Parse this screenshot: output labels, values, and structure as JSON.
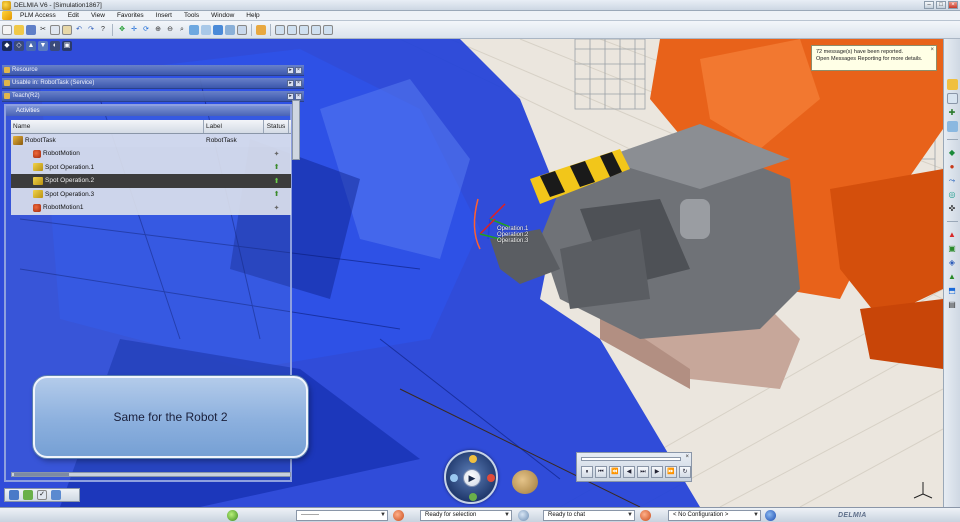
{
  "window": {
    "title": "DELMIA V6 - [Simulation1867]",
    "controls": [
      "–",
      "□",
      "×"
    ]
  },
  "menu": {
    "items": [
      "PLM Access",
      "Edit",
      "View",
      "Favorites",
      "Insert",
      "Tools",
      "Window",
      "Help"
    ]
  },
  "panel": {
    "strips": [
      "Resource",
      "Usable in: RobotTask (Service)",
      "Teach(R2)"
    ],
    "header": "Activities",
    "columns": {
      "name": "Name",
      "label": "Label",
      "status": "Status"
    },
    "rows": [
      {
        "name": "RobotTask",
        "label": "RobotTask",
        "status": "",
        "style": "task",
        "icon": "robot-task-icon"
      },
      {
        "name": "RobotMotion",
        "label": "",
        "status": "✦",
        "style": "light",
        "icon": "robot-motion-icon"
      },
      {
        "name": "Spot Operation.1",
        "label": "",
        "status": "⬆",
        "style": "light",
        "icon": "spot-operation-icon"
      },
      {
        "name": "Spot Operation.2",
        "label": "",
        "status": "⬆",
        "style": "dark",
        "icon": "spot-operation-icon"
      },
      {
        "name": "Spot Operation.3",
        "label": "",
        "status": "⬆",
        "style": "light",
        "icon": "spot-operation-icon"
      },
      {
        "name": "RobotMotion1",
        "label": "",
        "status": "✦",
        "style": "light",
        "icon": "robot-motion-icon"
      }
    ]
  },
  "caption": {
    "text": "Same for the Robot 2"
  },
  "message": {
    "line1": "72 message(s) have been reported.",
    "line2": "Open Messages Reporting for more details."
  },
  "viewport_labels": [
    "Operation.1",
    "Operation.2",
    "Operation.3"
  ],
  "player": {
    "buttons": [
      "⏸",
      "⏮",
      "⏪",
      "◀",
      "⏭",
      "▶",
      "⏩",
      "↻"
    ]
  },
  "statusbar": {
    "field1": "---------",
    "field2": "Ready for selection",
    "field3": "Ready to chat",
    "field4": "< No Configuration >",
    "brand": "DELMIA"
  },
  "colors": {
    "car_body": "#1f3fd8",
    "robot_orange": "#e8621a",
    "gun_gray": "#6f7277",
    "caption_blue": "#8cb0de"
  }
}
